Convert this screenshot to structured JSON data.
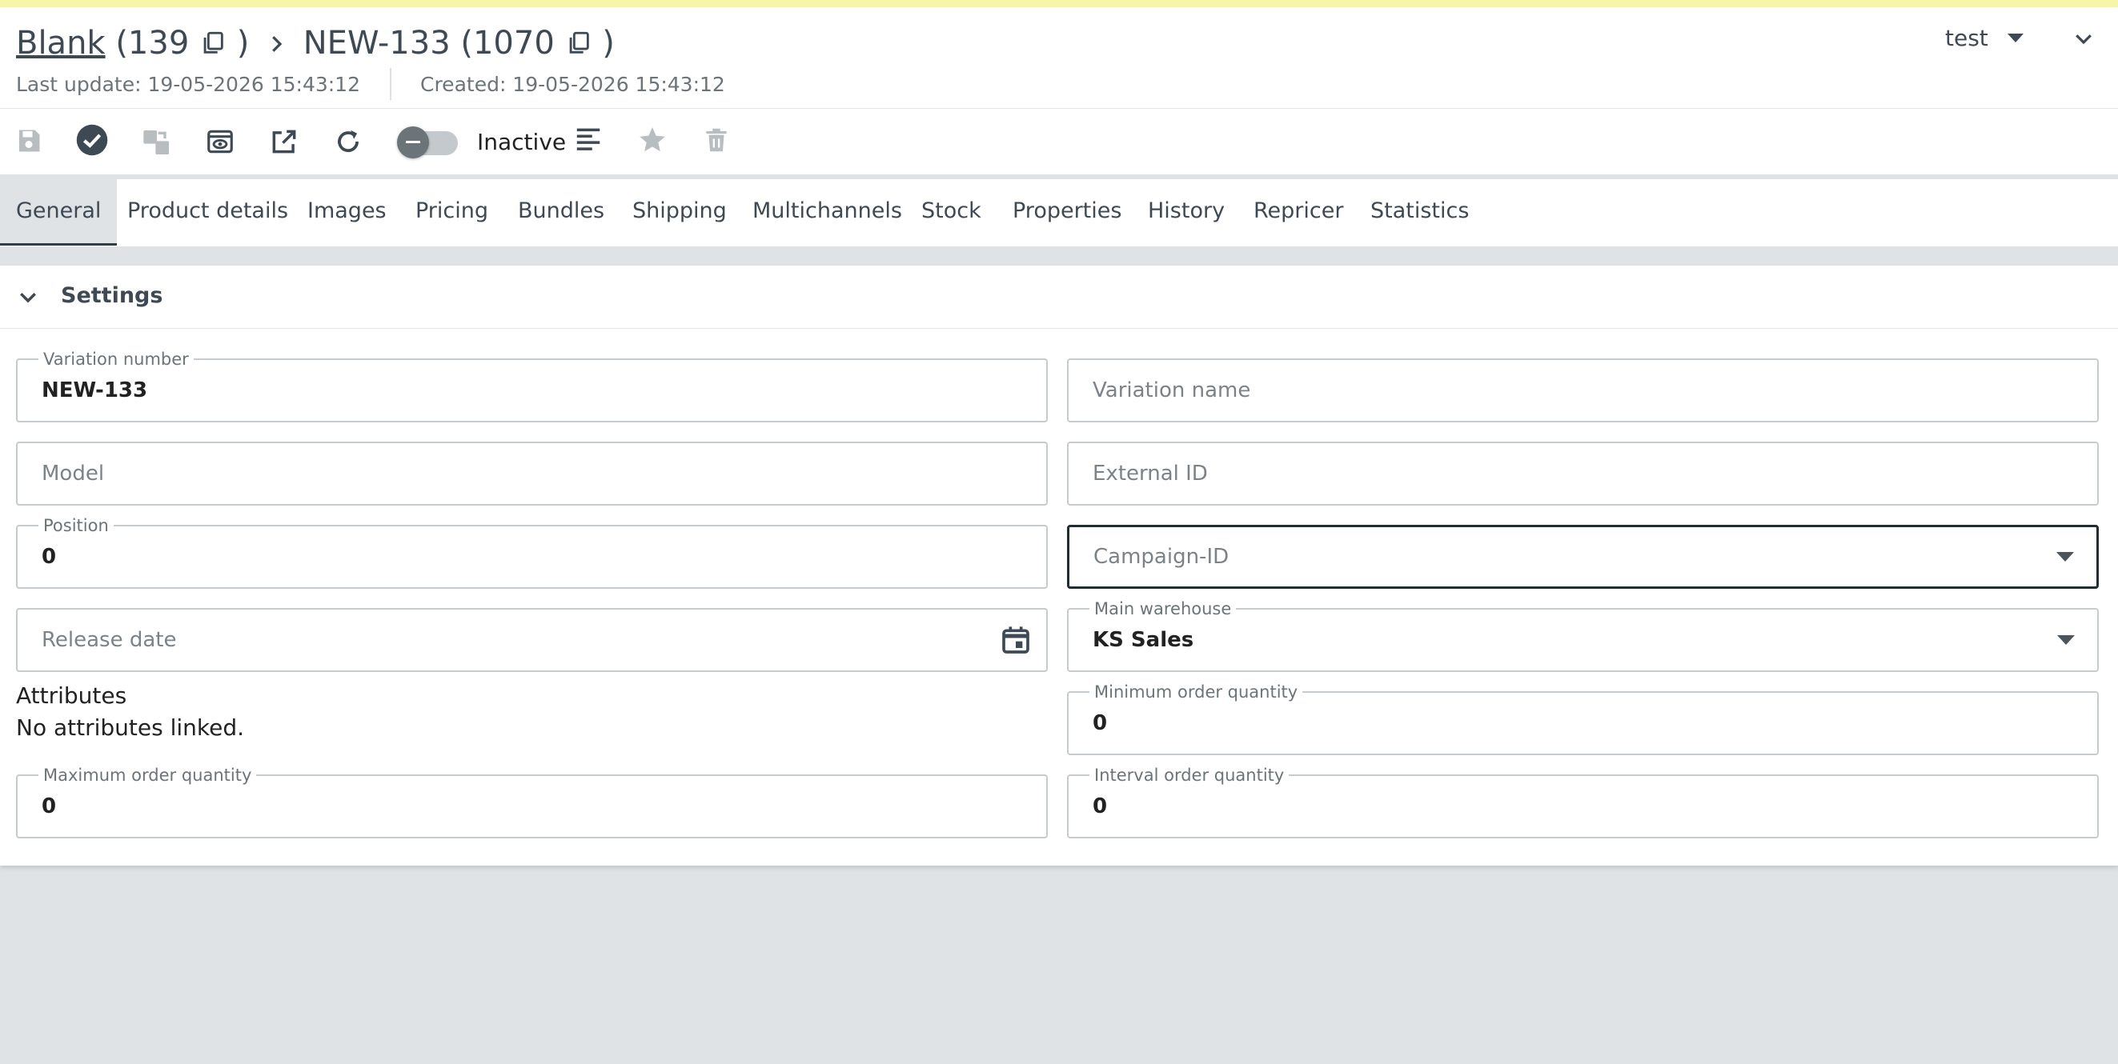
{
  "header": {
    "breadcrumb": {
      "parent_label": "Blank",
      "parent_id": "(139",
      "parent_close": ")",
      "current_label": "NEW-133",
      "current_id": "(1070",
      "current_close": ")"
    },
    "last_update": "Last update: 19-05-2026 15:43:12",
    "created": "Created: 19-05-2026 15:43:12",
    "user_menu": "test"
  },
  "toolbar": {
    "status_label": "Inactive",
    "status_active": false
  },
  "tabs": [
    {
      "label": "General",
      "active": true
    },
    {
      "label": "Product details"
    },
    {
      "label": "Images"
    },
    {
      "label": "Pricing"
    },
    {
      "label": "Bundles"
    },
    {
      "label": "Shipping"
    },
    {
      "label": "Multichannels"
    },
    {
      "label": "Stock"
    },
    {
      "label": "Properties"
    },
    {
      "label": "History"
    },
    {
      "label": "Repricer"
    },
    {
      "label": "Statistics"
    }
  ],
  "settings": {
    "title": "Settings",
    "fields": {
      "variation_number": {
        "label": "Variation number",
        "value": "NEW-133"
      },
      "variation_name": {
        "placeholder": "Variation name"
      },
      "model": {
        "placeholder": "Model"
      },
      "external_id": {
        "placeholder": "External ID"
      },
      "position": {
        "label": "Position",
        "value": "0"
      },
      "campaign_id": {
        "placeholder": "Campaign-ID"
      },
      "release_date": {
        "placeholder": "Release date"
      },
      "main_warehouse": {
        "label": "Main warehouse",
        "value": "KS Sales"
      },
      "minimum_order_quantity": {
        "label": "Minimum order quantity",
        "value": "0"
      },
      "maximum_order_quantity": {
        "label": "Maximum order quantity",
        "value": "0"
      },
      "interval_order_quantity": {
        "label": "Interval order quantity",
        "value": "0"
      }
    },
    "attributes": {
      "heading": "Attributes",
      "empty_text": "No attributes linked."
    }
  },
  "colors": {
    "primary_text": "#3d4a55",
    "background": "#dfe3e6",
    "focus_border": "#1f2d36",
    "icon_active": "#3d4a55",
    "icon_disabled": "#b8bdc0"
  }
}
